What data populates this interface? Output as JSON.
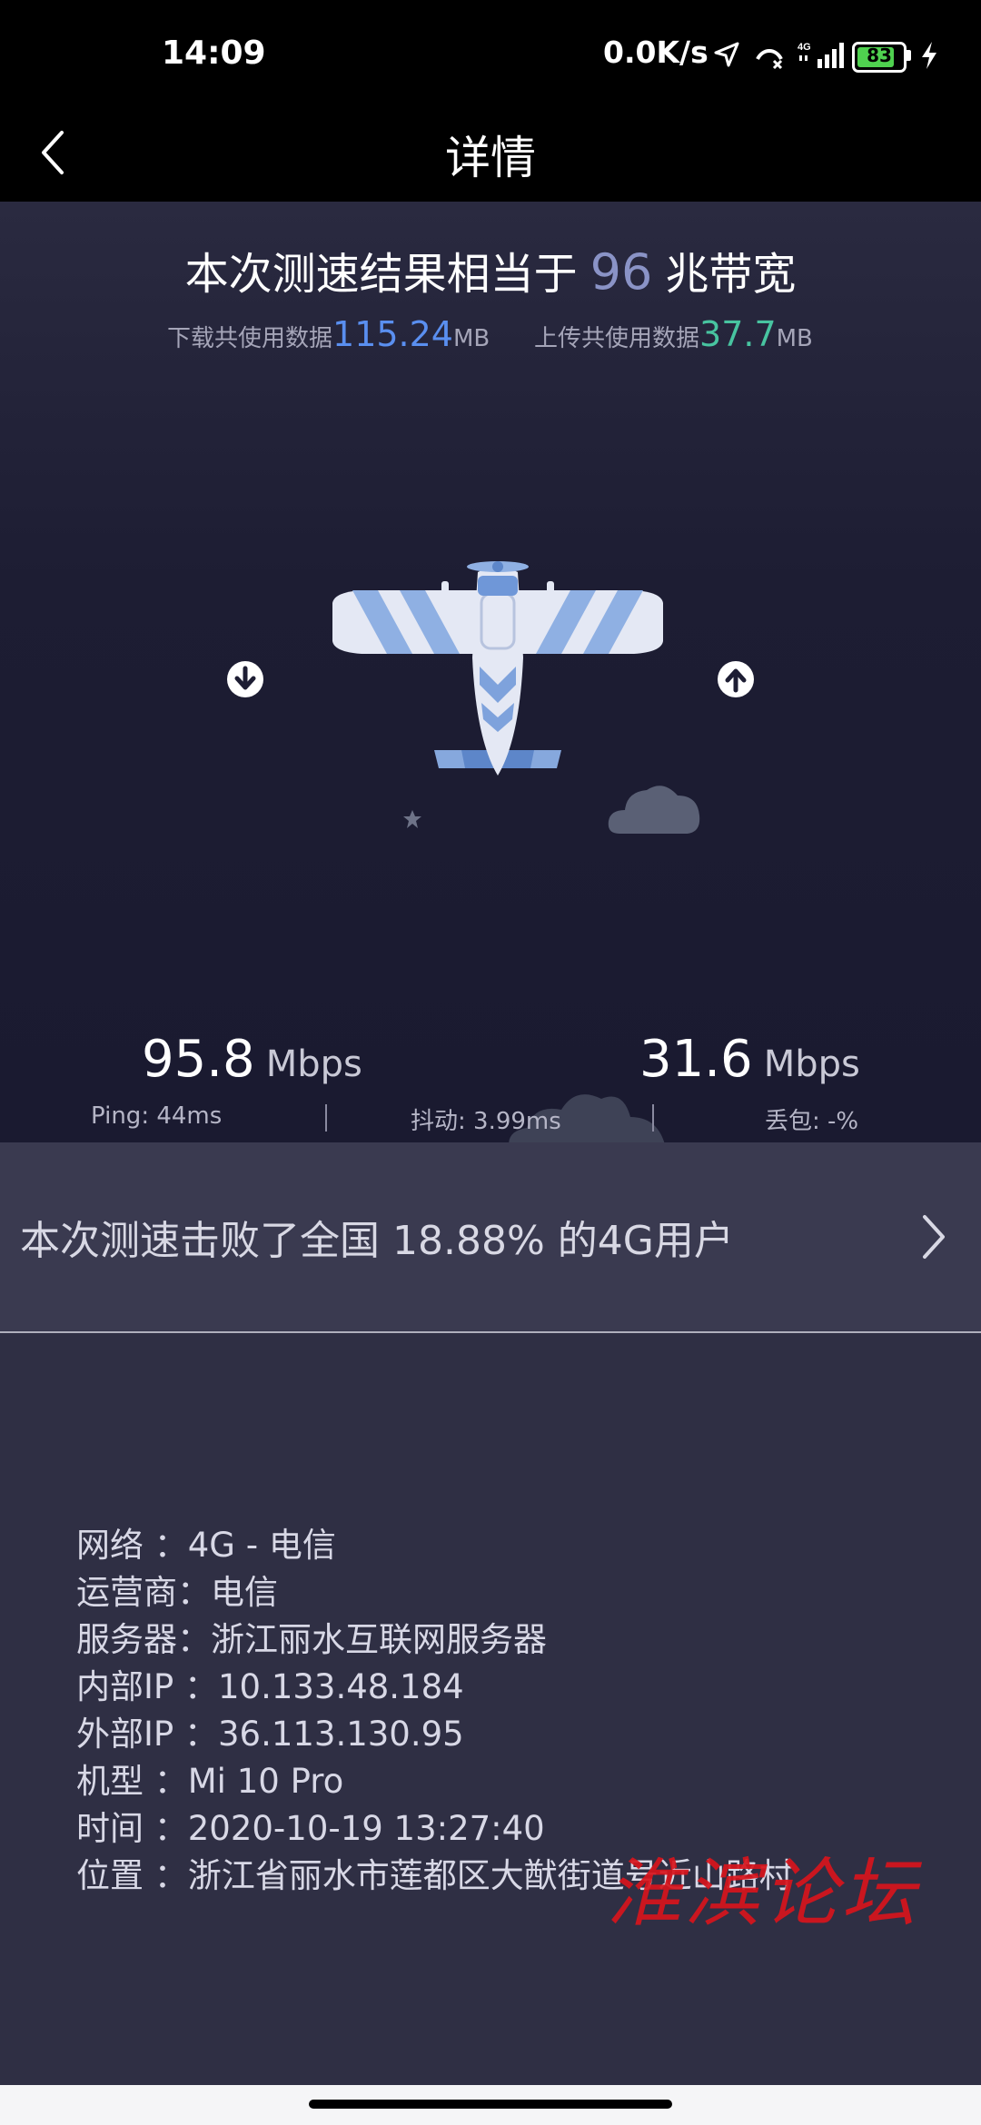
{
  "status_bar": {
    "time": "14:09",
    "net_speed": "0.0K/s",
    "network_type": "4G",
    "battery": "83",
    "battery_level": 0.83,
    "icons": [
      "location-arrow-icon",
      "missed-call-icon",
      "signal-icon",
      "battery-icon",
      "charging-bolt-icon"
    ]
  },
  "header": {
    "title": "详情",
    "back_icon": "chevron-left-icon"
  },
  "result": {
    "headline_prefix": "本次测速结果相当于",
    "bandwidth": "96",
    "headline_suffix": "兆带宽",
    "download_usage_label": "下载共使用数据",
    "download_usage_value": "115.24",
    "download_usage_unit": "MB",
    "upload_usage_label": "上传共使用数据",
    "upload_usage_value": "37.7",
    "upload_usage_unit": "MB",
    "download_speed": "95.8",
    "download_unit": "Mbps",
    "upload_speed": "31.6",
    "upload_unit": "Mbps",
    "ping": "Ping:  44ms",
    "jitter": "抖动:  3.99ms",
    "packet_loss": "丢包:  -%"
  },
  "rank": {
    "text": "本次测速击败了全国 18.88% 的4G用户"
  },
  "info": [
    "网络 ：4G - 电信",
    "运营商：电信",
    "服务器：浙江丽水互联网服务器",
    "内部IP ：10.133.48.184",
    "外部IP ：36.113.130.95",
    "机型 ：Mi 10 Pro",
    "时间 ：2020-10-19 13:27:40",
    "位置 ：浙江省丽水市莲都区大猷街道号近山路村"
  ],
  "watermark": "淮滨论坛",
  "colors": {
    "accent_download": "#5a8ff0",
    "accent_upload": "#48c4a0",
    "bandwidth_number": "#8a93c6",
    "watermark": "#d8141c"
  }
}
